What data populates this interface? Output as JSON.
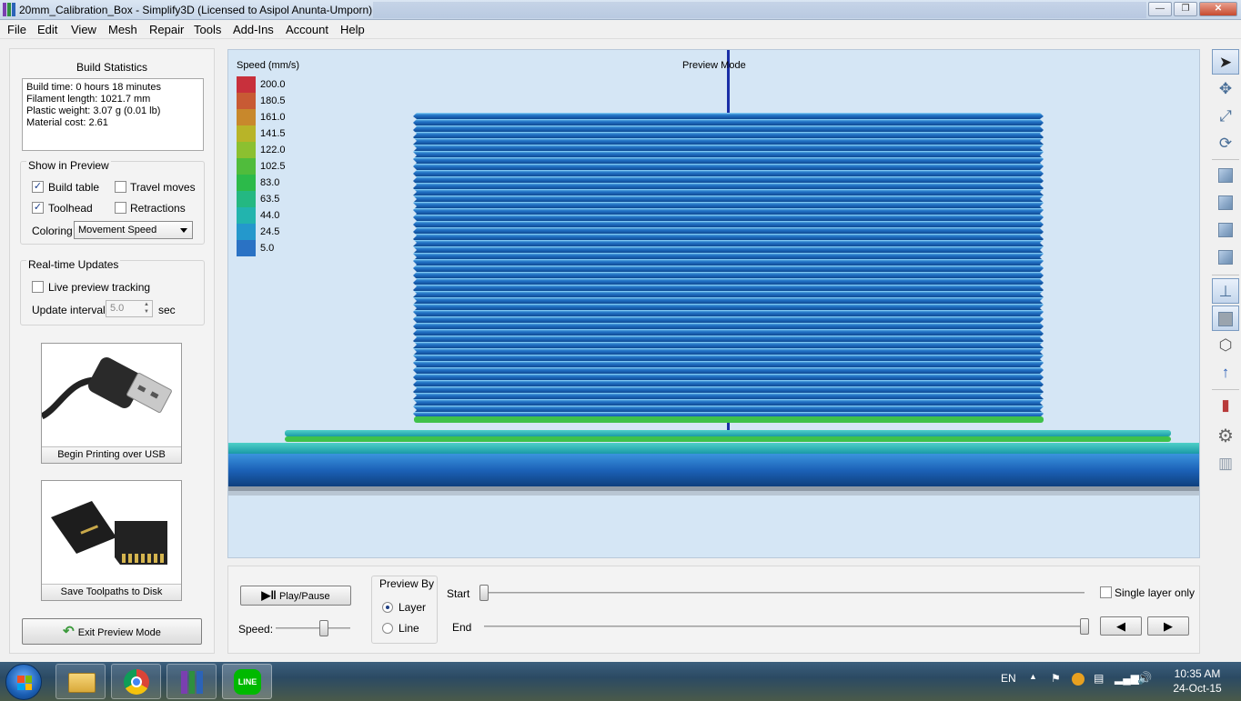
{
  "window": {
    "title": "20mm_Calibration_Box - Simplify3D (Licensed to Asipol Anunta-Umporn)",
    "controls": {
      "minimize": "—",
      "maximize": "❐",
      "close": "✕"
    }
  },
  "menu": [
    "File",
    "Edit",
    "View",
    "Mesh",
    "Repair",
    "Tools",
    "Add-Ins",
    "Account",
    "Help"
  ],
  "build_statistics": {
    "heading": "Build Statistics",
    "lines": [
      "Build time: 0 hours 18 minutes",
      "Filament length: 1021.7 mm",
      "Plastic weight: 3.07 g (0.01 lb)",
      "Material cost: 2.61"
    ]
  },
  "show_in_preview": {
    "heading": "Show in Preview",
    "build_table": {
      "label": "Build table",
      "checked": true,
      "mark": "✓"
    },
    "travel_moves": {
      "label": "Travel moves",
      "checked": false,
      "mark": ""
    },
    "toolhead": {
      "label": "Toolhead",
      "checked": true,
      "mark": "✓"
    },
    "retractions": {
      "label": "Retractions",
      "checked": false,
      "mark": ""
    },
    "coloring_label": "Coloring",
    "coloring_value": "Movement Speed"
  },
  "realtime": {
    "heading": "Real-time Updates",
    "live_tracking": {
      "label": "Live preview tracking",
      "checked": false,
      "mark": ""
    },
    "interval_label": "Update interval",
    "interval_value": "5.0",
    "interval_unit": "sec"
  },
  "actions": {
    "usb_print": "Begin Printing over USB",
    "save_toolpaths": "Save Toolpaths to Disk",
    "exit_preview": "Exit Preview Mode"
  },
  "viewport": {
    "mode_label": "Preview Mode",
    "background": "#d5e6f5",
    "legend": {
      "title": "Speed (mm/s)",
      "entries": [
        {
          "value": "200.0",
          "color": "#c8303c"
        },
        {
          "value": "180.5",
          "color": "#c85a34"
        },
        {
          "value": "161.0",
          "color": "#c8882c"
        },
        {
          "value": "141.5",
          "color": "#b8b428"
        },
        {
          "value": "122.0",
          "color": "#8cc030"
        },
        {
          "value": "102.5",
          "color": "#50bc3c"
        },
        {
          "value": "83.0",
          "color": "#2cba4a"
        },
        {
          "value": "63.5",
          "color": "#24b882"
        },
        {
          "value": "44.0",
          "color": "#22b4ae"
        },
        {
          "value": "24.5",
          "color": "#2498cc"
        },
        {
          "value": "5.0",
          "color": "#2a72c4"
        }
      ]
    }
  },
  "playback": {
    "play_pause": "Play/Pause",
    "speed_label": "Speed:",
    "speed_level": 0.65,
    "preview_by": {
      "heading": "Preview By",
      "options": [
        "Layer",
        "Line"
      ],
      "selected": "Layer"
    },
    "start_label": "Start",
    "end_label": "End",
    "start_position": 0.0,
    "end_position": 1.0,
    "single_layer": {
      "label": "Single layer only",
      "checked": false,
      "mark": ""
    },
    "prev_glyph": "◀",
    "next_glyph": "▶"
  },
  "toolbar_icons": [
    "select-arrow-icon",
    "move-icon",
    "scale-icon",
    "rotate-icon",
    "cube-view-1-icon",
    "cube-view-2-icon",
    "cube-view-3-icon",
    "cube-view-4-icon",
    "axes-icon",
    "solid-cube-icon",
    "wireframe-cube-icon",
    "normal-icon",
    "section-icon",
    "settings-gear-icon",
    "build-table-icon"
  ],
  "taskbar": {
    "apps": [
      "explorer-icon",
      "chrome-icon",
      "simplify3d-icon",
      "line-icon"
    ],
    "line_label": "LINE",
    "language": "EN",
    "time": "10:35 AM",
    "date": "24-Oct-15"
  },
  "colors": {
    "accent_blue": "#2a72c4",
    "layer_blue": "#1f6cc0",
    "green": "#2cba4a",
    "teal": "#22b4ae"
  }
}
